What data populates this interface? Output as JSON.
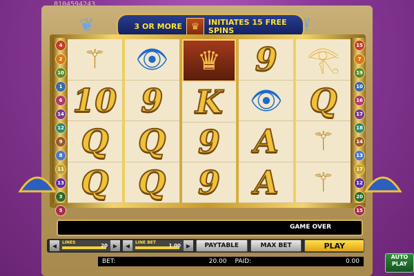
{
  "game_id": "8104594243",
  "header": {
    "line1": "3 OR MORE",
    "line2": "INITIATES 15 FREE",
    "line3": "SPINS",
    "icon": "sphinx-icon"
  },
  "paylines_left": [
    "4",
    "2",
    "10",
    "1",
    "6",
    "14",
    "12",
    "9",
    "8",
    "11",
    "13",
    "3",
    "5"
  ],
  "paylines_right": [
    "15",
    "7",
    "19",
    "10",
    "16",
    "17",
    "18",
    "14",
    "13",
    "17",
    "12",
    "20",
    "15"
  ],
  "payline_colors": [
    "#c43d2c",
    "#d77a1b",
    "#5a8a2c",
    "#3b6aa6",
    "#b03a6a",
    "#7a3b8f",
    "#2c8a6f",
    "#9a5a2b",
    "#4a7acb",
    "#c2a12a",
    "#5e2ca6",
    "#2c6a2c",
    "#a62c4e"
  ],
  "reels": [
    [
      "staff-icon",
      "10",
      "Q",
      "Q"
    ],
    [
      "eye-icon",
      "9",
      "Q",
      "Q"
    ],
    [
      "sphinx-icon",
      "K",
      "9",
      "9"
    ],
    [
      "9",
      "eye-icon",
      "A",
      "A"
    ],
    [
      "tablet-icon",
      "Q",
      "staff-icon",
      "staff-icon"
    ]
  ],
  "status": {
    "message": "GAME OVER"
  },
  "controls": {
    "lines_label": "LINES",
    "lines_value": "20",
    "line_bet_label": "LINE BET",
    "line_bet_value": "1.00",
    "paytable": "PAYTABLE",
    "max_bet": "MAX BET",
    "play": "PLAY",
    "autoplay_line1": "AUTO",
    "autoplay_line2": "PLAY"
  },
  "info": {
    "bet_label": "BET:",
    "bet_value": "20.00",
    "paid_label": "PAID:",
    "paid_value": "0.00"
  },
  "colors": {
    "accent_gold": "#f0c13a",
    "play_yellow": "#ffe04a",
    "background_purple": "#8a3a98"
  }
}
